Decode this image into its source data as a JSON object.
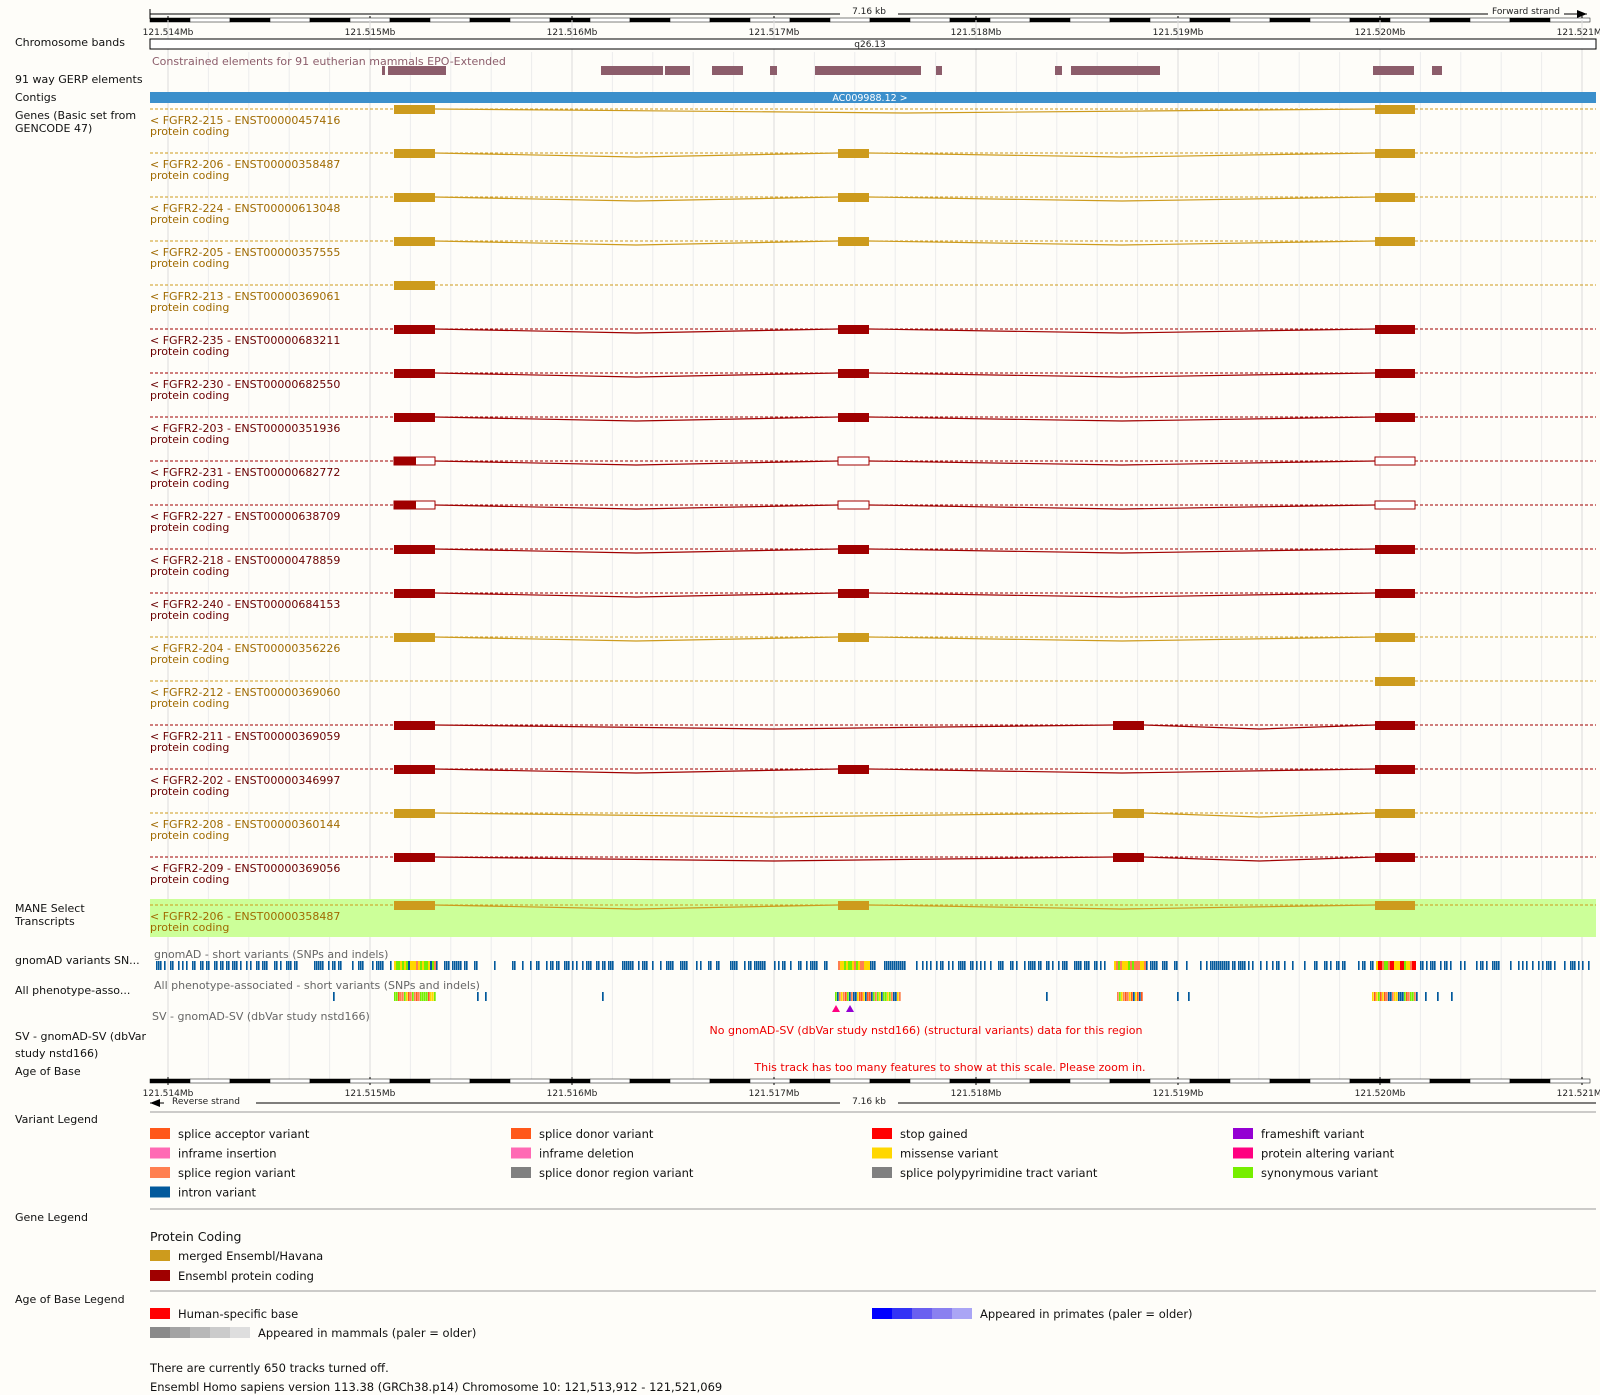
{
  "scale": {
    "top_span": "7.16 kb",
    "forward_strand": "Forward strand",
    "reverse_strand": "Reverse strand",
    "ticks": [
      "121.514Mb",
      "121.515Mb",
      "121.516Mb",
      "121.517Mb",
      "121.518Mb",
      "121.519Mb",
      "121.520Mb",
      "121.521Mb"
    ]
  },
  "track_labels": {
    "chromosome_bands": "Chromosome bands",
    "gerp": "91 way GERP elements",
    "contigs": "Contigs",
    "genes_line1": "Genes (Basic set from",
    "genes_line2": "GENCODE 47)",
    "mane_line1": "MANE Select",
    "mane_line2": "Transcripts",
    "gnomad": "gnomAD variants SN...",
    "phenotype": "All phenotype-asso...",
    "sv_line1": "SV - gnomAD-SV (dbVar",
    "sv_line2": "study nstd166)",
    "age": "Age of Base"
  },
  "band_name": "q26.13",
  "gerp_caption": "Constrained elements for 91 eutherian mammals EPO-Extended",
  "contig_name": "AC009988.12 >",
  "transcripts": [
    {
      "name": "< FGFR2-215 - ENST00000457416",
      "biotype": "protein coding",
      "type": "merged",
      "exons": [
        1,
        5
      ]
    },
    {
      "name": "< FGFR2-206 - ENST00000358487",
      "biotype": "protein coding",
      "type": "merged",
      "exons": [
        1,
        3,
        5
      ]
    },
    {
      "name": "< FGFR2-224 - ENST00000613048",
      "biotype": "protein coding",
      "type": "merged",
      "exons": [
        1,
        3,
        5
      ]
    },
    {
      "name": "< FGFR2-205 - ENST00000357555",
      "biotype": "protein coding",
      "type": "merged",
      "exons": [
        1,
        3,
        5
      ]
    },
    {
      "name": "< FGFR2-213 - ENST00000369061",
      "biotype": "protein coding",
      "type": "merged",
      "exons": [
        1
      ]
    },
    {
      "name": "< FGFR2-235 - ENST00000683211",
      "biotype": "protein coding",
      "type": "ensembl",
      "exons": [
        1,
        3,
        5
      ]
    },
    {
      "name": "< FGFR2-230 - ENST00000682550",
      "biotype": "protein coding",
      "type": "ensembl",
      "exons": [
        1,
        3,
        5
      ]
    },
    {
      "name": "< FGFR2-203 - ENST00000351936",
      "biotype": "protein coding",
      "type": "ensembl",
      "exons": [
        1,
        3,
        5
      ]
    },
    {
      "name": "< FGFR2-231 - ENST00000682772",
      "biotype": "protein coding",
      "type": "ensembl-utr",
      "exons": [
        1,
        3,
        5
      ]
    },
    {
      "name": "< FGFR2-227 - ENST00000638709",
      "biotype": "protein coding",
      "type": "ensembl-utr",
      "exons": [
        1,
        3,
        5
      ]
    },
    {
      "name": "< FGFR2-218 - ENST00000478859",
      "biotype": "protein coding",
      "type": "ensembl",
      "exons": [
        1,
        3,
        5
      ]
    },
    {
      "name": "< FGFR2-240 - ENST00000684153",
      "biotype": "protein coding",
      "type": "ensembl",
      "exons": [
        1,
        3,
        5
      ]
    },
    {
      "name": "< FGFR2-204 - ENST00000356226",
      "biotype": "protein coding",
      "type": "merged",
      "exons": [
        1,
        3,
        5
      ]
    },
    {
      "name": "< FGFR2-212 - ENST00000369060",
      "biotype": "protein coding",
      "type": "merged",
      "exons": [
        5
      ]
    },
    {
      "name": "< FGFR2-211 - ENST00000369059",
      "biotype": "protein coding",
      "type": "ensembl",
      "exons": [
        1,
        4,
        5
      ]
    },
    {
      "name": "< FGFR2-202 - ENST00000346997",
      "biotype": "protein coding",
      "type": "ensembl",
      "exons": [
        1,
        3,
        5
      ]
    },
    {
      "name": "< FGFR2-208 - ENST00000360144",
      "biotype": "protein coding",
      "type": "merged",
      "exons": [
        1,
        4,
        5
      ]
    },
    {
      "name": "< FGFR2-209 - ENST00000369056",
      "biotype": "protein coding",
      "type": "ensembl",
      "exons": [
        1,
        4,
        5
      ]
    }
  ],
  "mane": {
    "name": "< FGFR2-206 - ENST00000358487",
    "biotype": "protein coding"
  },
  "gnomad_caption": "gnomAD - short variants (SNPs and indels)",
  "phenotype_caption": "All phenotype-associated - short variants (SNPs and indels)",
  "sv_caption": "SV - gnomAD-SV (dbVar study nstd166)",
  "sv_message": "No gnomAD-SV (dbVar study nstd166) (structural variants) data for this region",
  "age_message": "This track has too many features to show at this scale. Please zoom in.",
  "variant_legend": {
    "title": "Variant Legend",
    "items": [
      {
        "label": "splice acceptor variant",
        "color": "#ff581a"
      },
      {
        "label": "splice donor variant",
        "color": "#ff581a"
      },
      {
        "label": "stop gained",
        "color": "#ff0000"
      },
      {
        "label": "frameshift variant",
        "color": "#9400d3"
      },
      {
        "label": "inframe insertion",
        "color": "#ff69b4"
      },
      {
        "label": "inframe deletion",
        "color": "#ff69b4"
      },
      {
        "label": "missense variant",
        "color": "#ffd700"
      },
      {
        "label": "protein altering variant",
        "color": "#ff0080"
      },
      {
        "label": "splice region variant",
        "color": "#ff7f50"
      },
      {
        "label": "splice donor region variant",
        "color": "#808080"
      },
      {
        "label": "splice polypyrimidine tract variant",
        "color": "#808080"
      },
      {
        "label": "synonymous variant",
        "color": "#76ee00"
      },
      {
        "label": "intron variant",
        "color": "#02599c"
      }
    ]
  },
  "gene_legend": {
    "title": "Gene Legend",
    "subtitle": "Protein Coding",
    "items": [
      {
        "label": "merged Ensembl/Havana",
        "color": "#cd9b1d"
      },
      {
        "label": "Ensembl protein coding",
        "color": "#a00000"
      }
    ]
  },
  "age_legend": {
    "title": "Age of Base Legend",
    "human": "Human-specific base",
    "primates": "Appeared in primates (paler = older)",
    "mammals": "Appeared in mammals (paler = older)"
  },
  "footer": {
    "tracks_off": "There are currently 650 tracks turned off.",
    "version": "Ensembl Homo sapiens version 113.38 (GRCh38.p14) Chromosome 10: 121,513,912 - 121,521,069"
  },
  "colors": {
    "merged": "#cd9b1d",
    "merged_text": "#a06a00",
    "ensembl": "#a00000",
    "ensembl_text": "#6a0000",
    "contig": "#3b8fcb",
    "gerp": "#8c5d6b",
    "mane_bg": "#ccff99",
    "intron_variant": "#02599c",
    "human_specific": "#ff0000"
  }
}
